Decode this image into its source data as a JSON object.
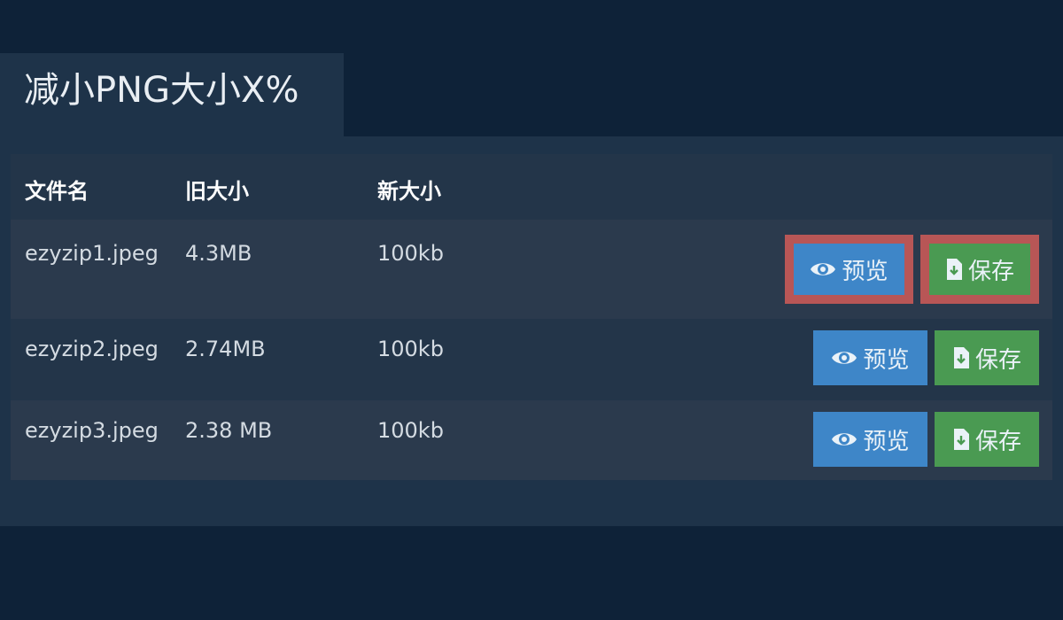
{
  "tab": {
    "title": "减小PNG大小X%"
  },
  "table": {
    "headers": [
      "文件名",
      "旧大小",
      "新大小"
    ],
    "rows": [
      {
        "filename": "ezyzip1.jpeg",
        "old_size": "4.3MB",
        "new_size": "100kb"
      },
      {
        "filename": "ezyzip2.jpeg",
        "old_size": "2.74MB",
        "new_size": "100kb"
      },
      {
        "filename": "ezyzip3.jpeg",
        "old_size": "2.38 MB",
        "new_size": "100kb"
      }
    ]
  },
  "buttons": {
    "preview_label": "预览",
    "save_label": "保存"
  },
  "icons": {
    "preview": "eye-icon",
    "save": "file-download-icon"
  },
  "colors": {
    "background": "#0e2238",
    "panel": "#1e3349",
    "preview_button": "#3e86c8",
    "save_button": "#4a9a52",
    "highlight": "#b85656"
  }
}
